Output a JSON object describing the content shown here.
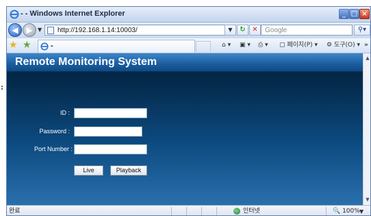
{
  "window": {
    "title": "- - Windows Internet Explorer"
  },
  "address": {
    "url": "http://192.168.1.14:10003/",
    "search_placeholder": "Google"
  },
  "tab": {
    "label": "-"
  },
  "commands": {
    "page": "페이지(P)",
    "tools": "도구(O)",
    "more": "»"
  },
  "banner": {
    "title": "Remote Monitoring System"
  },
  "form": {
    "id_label": "ID :",
    "password_label": "Password :",
    "port_label": "Port Number :",
    "live_button": "Live",
    "playback_button": "Playback"
  },
  "status": {
    "text": "완료",
    "zone": "인터넷",
    "zoom": "100%"
  },
  "colors": {
    "banner": "#1a5d9f",
    "content_top": "#02203c",
    "content_bottom": "#2a6fad"
  },
  "icons": [
    "ie-icon",
    "back-arrow-icon",
    "forward-arrow-icon",
    "page-icon",
    "refresh-icon",
    "stop-icon",
    "search-icon",
    "star-icon",
    "add-favorite-icon",
    "home-icon",
    "feed-icon",
    "print-icon",
    "internet-zone-icon"
  ]
}
